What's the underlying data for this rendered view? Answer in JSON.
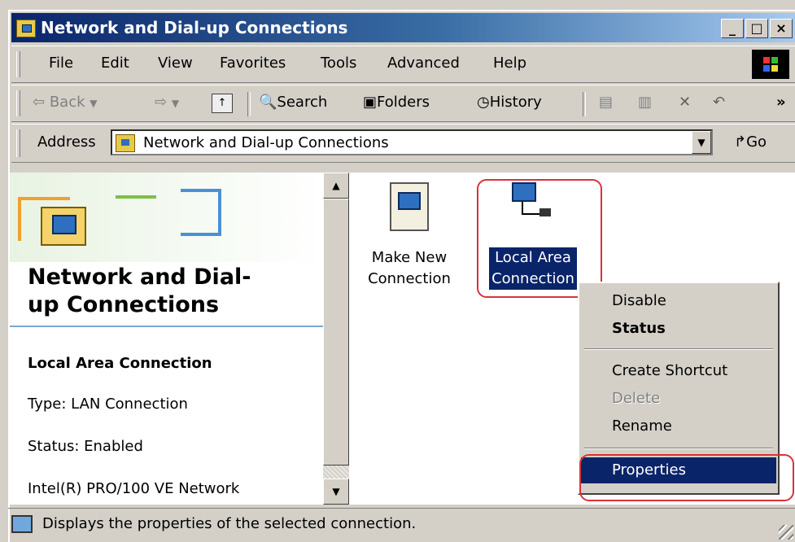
{
  "window": {
    "title": "Network and Dial-up Connections"
  },
  "title_buttons": [
    "_",
    "□",
    "×"
  ],
  "menu": [
    "File",
    "Edit",
    "View",
    "Favorites",
    "Tools",
    "Advanced",
    "Help"
  ],
  "toolbar": {
    "back": "Back",
    "search": "Search",
    "folders": "Folders",
    "history": "History",
    "more": "»"
  },
  "address": {
    "label": "Address",
    "value": "Network and Dial-up Connections",
    "go": "Go"
  },
  "left_pane": {
    "heading": "Network and Dial-up Connections",
    "heading_line1": "Network and Dial-",
    "heading_line2": "up Connections",
    "selected_name": "Local Area Connection",
    "type": "Type: LAN Connection",
    "status": "Status: Enabled",
    "device": "Intel(R) PRO/100 VE Network"
  },
  "icons": [
    {
      "line1": "Make New",
      "line2": "Connection"
    },
    {
      "line1": "Local Area",
      "line2": "Connection"
    }
  ],
  "context_menu": {
    "disable": "Disable",
    "status": "Status",
    "create_shortcut": "Create Shortcut",
    "delete": "Delete",
    "rename": "Rename",
    "properties": "Properties"
  },
  "statusbar": {
    "text": "Displays the properties of the selected connection."
  },
  "colors": {
    "title_start": "#0a246a",
    "title_end": "#a6caf0",
    "selection": "#0a246a",
    "highlight": "#d9323a"
  }
}
